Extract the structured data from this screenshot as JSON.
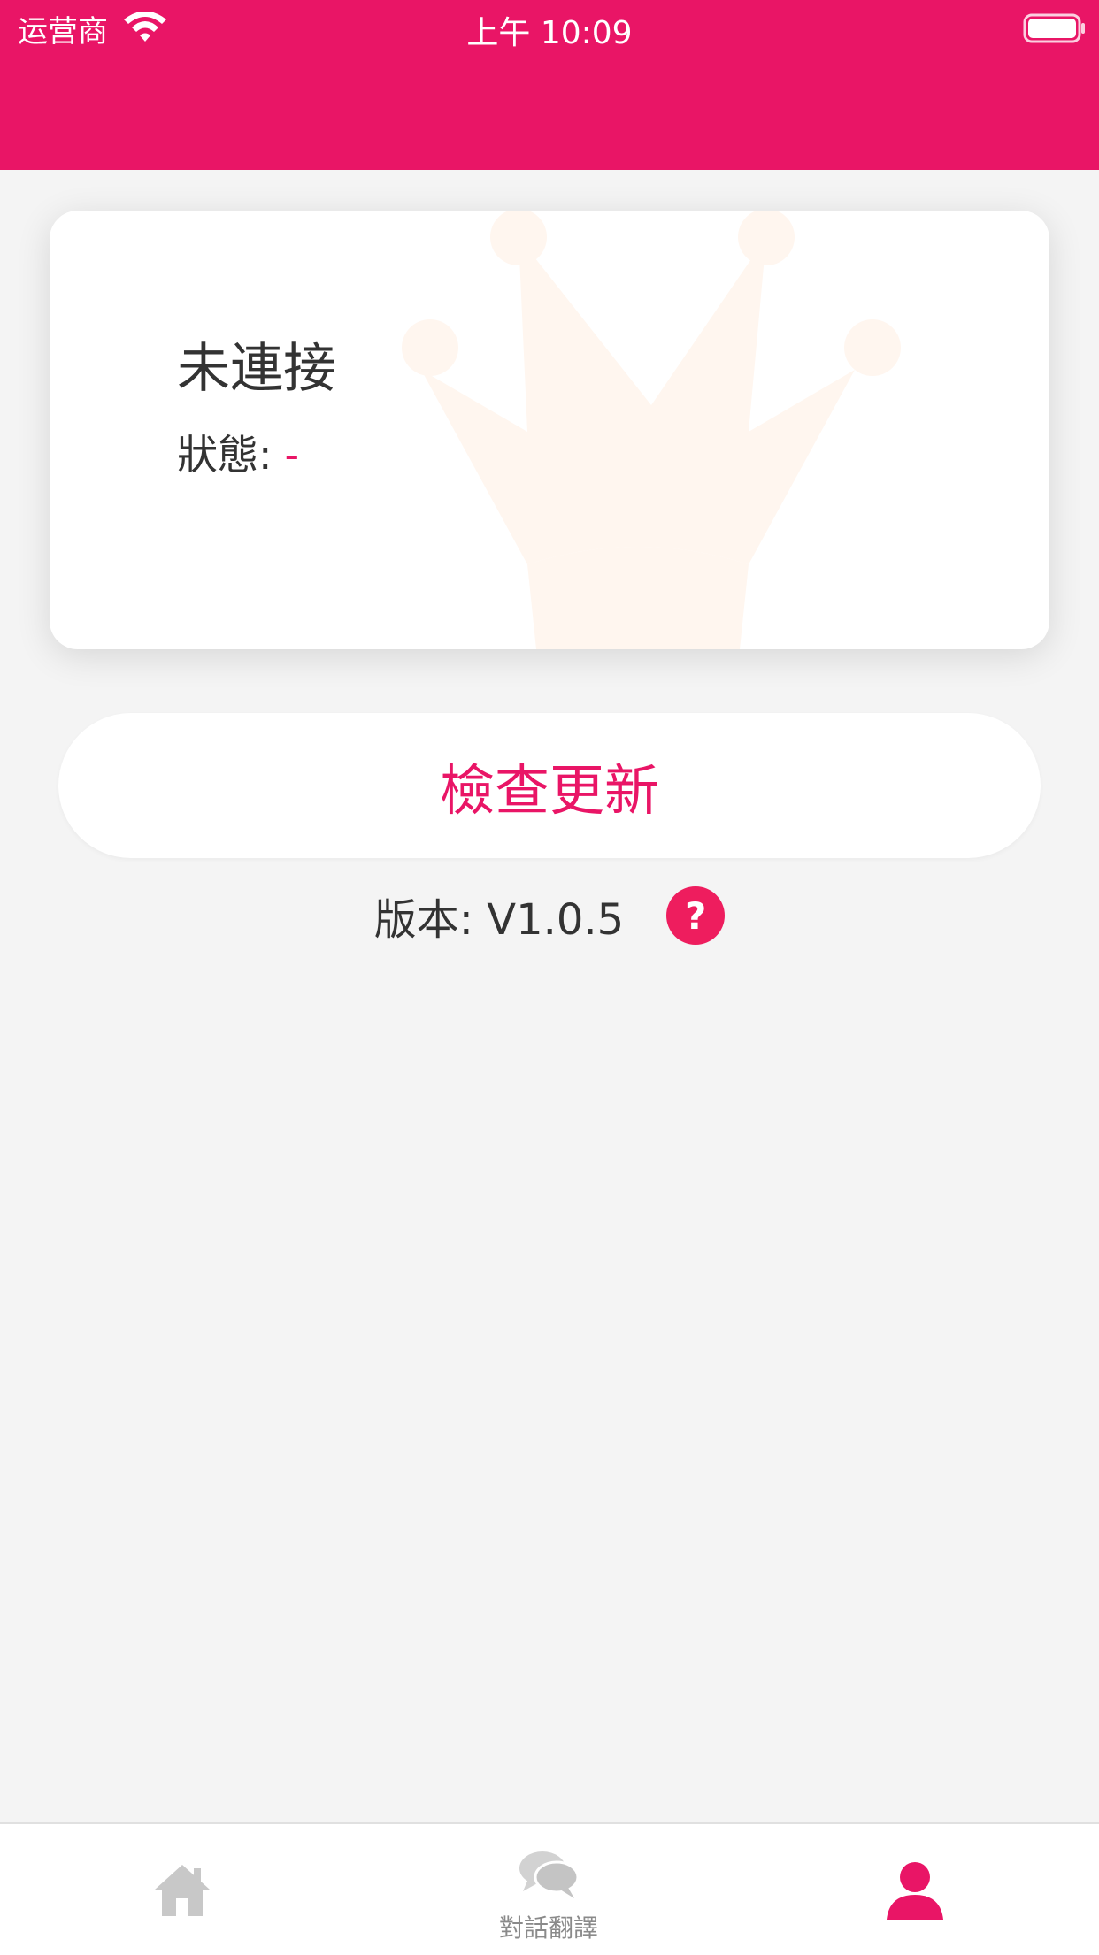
{
  "status_bar": {
    "carrier": "运营商",
    "time": "上午 10:09"
  },
  "colors": {
    "primary": "#e91566",
    "background": "#f4f4f4",
    "inactive_tab": "#c8c8c8"
  },
  "device_card": {
    "title": "未連接",
    "status_label": "狀態:",
    "status_value": "-",
    "background_icon": "crown-icon"
  },
  "update": {
    "button_label": "檢查更新"
  },
  "version": {
    "text": "版本: V1.0.5",
    "help_icon": "question-mark-icon"
  },
  "tab_bar": {
    "tabs": [
      {
        "icon": "home-icon",
        "label": "",
        "active": false
      },
      {
        "icon": "chat-bubbles-icon",
        "label": "對話翻譯",
        "active": false
      },
      {
        "icon": "person-icon",
        "label": "",
        "active": true
      }
    ]
  }
}
